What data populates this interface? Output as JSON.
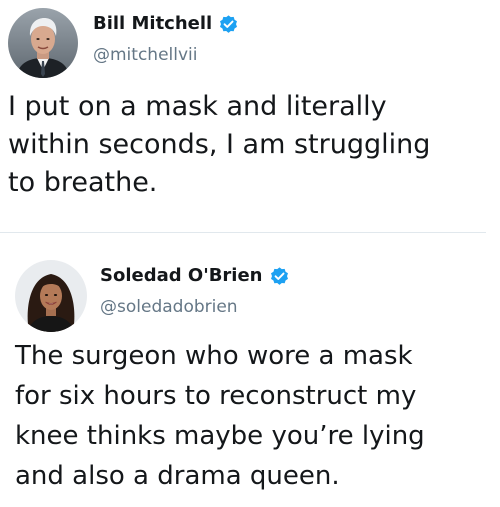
{
  "tweets": [
    {
      "display_name": "Bill Mitchell",
      "handle": "@mitchellvii",
      "verified": true,
      "text": "I put on a mask and literally\nwithin seconds, I am struggling\nto breathe.",
      "avatar_icon": "profile-photo-man-suit"
    },
    {
      "display_name": "Soledad O'Brien",
      "handle": "@soledadobrien",
      "verified": true,
      "text": "The surgeon who wore a mask\nfor six hours to reconstruct my\nknee thinks maybe you’re lying\nand also a drama queen.",
      "avatar_icon": "profile-photo-woman"
    }
  ],
  "colors": {
    "verified_badge": "#1da1f2",
    "handle": "#657786",
    "text": "#14171a",
    "divider": "#e1e8ed"
  }
}
